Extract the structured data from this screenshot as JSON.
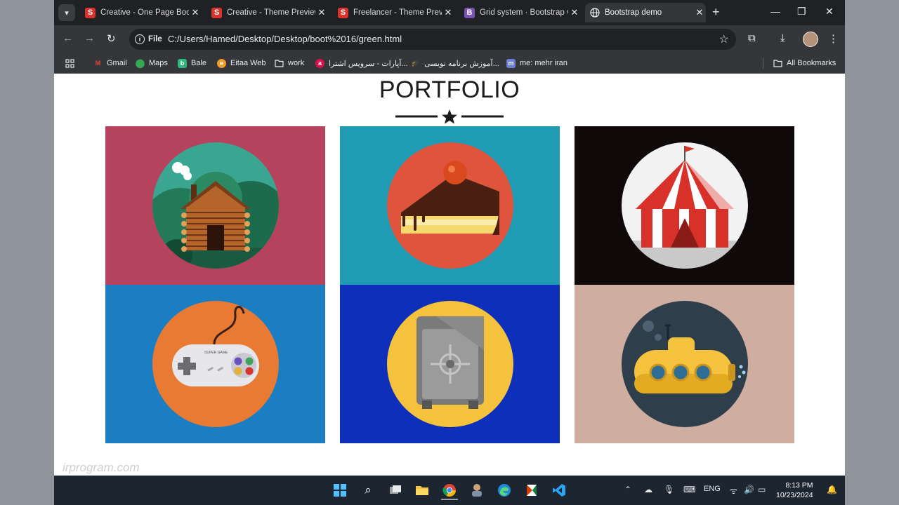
{
  "browser": {
    "tabs": [
      {
        "title": "Creative - One Page Boot",
        "favicon": "S",
        "favicon_color": "#d9342b",
        "active": false
      },
      {
        "title": "Creative - Theme Preview",
        "favicon": "S",
        "favicon_color": "#d9342b",
        "active": false
      },
      {
        "title": "Freelancer - Theme Previ",
        "favicon": "S",
        "favicon_color": "#d9342b",
        "active": false
      },
      {
        "title": "Grid system · Bootstrap v",
        "favicon": "B",
        "favicon_color": "#7952b3",
        "active": false
      },
      {
        "title": "Bootstrap demo",
        "favicon": "globe",
        "favicon_color": "#5f6368",
        "active": true
      }
    ],
    "address": {
      "scheme_label": "File",
      "url": "C:/Users/Hamed/Desktop/Desktop/boot%2016/green.html"
    },
    "bookmarks": [
      {
        "label": "Gmail",
        "icon": "gmail-icon",
        "color": "#ea4335"
      },
      {
        "label": "Maps",
        "icon": "maps-icon",
        "color": "#34a853"
      },
      {
        "label": "Bale",
        "icon": "bale-icon",
        "color": "#2eb67d"
      },
      {
        "label": "Eitaa Web",
        "icon": "eitaa-icon",
        "color": "#f29b2a"
      },
      {
        "label": "work",
        "icon": "folder-icon",
        "color": "#e8eaed"
      },
      {
        "label": "آپارات - سرویس اشترا...",
        "icon": "aparat-icon",
        "color": "#df0f50"
      },
      {
        "label": "آموزش برنامه نویسی...",
        "icon": "cap-icon",
        "color": "#e8eaed"
      },
      {
        "label": "me: mehr iran",
        "icon": "mehr-icon",
        "color": "#6b7fd7"
      }
    ],
    "all_bookmarks_label": "All Bookmarks"
  },
  "page": {
    "title": "PORTFOLIO",
    "tiles": [
      {
        "icon": "cabin-icon",
        "bg": "#b5435d",
        "circle": "#3aa591"
      },
      {
        "icon": "cake-icon",
        "bg": "#1f9cb3",
        "circle": "#e0533d"
      },
      {
        "icon": "circus-tent-icon",
        "bg": "#0f0a09",
        "circle": "#f2f2f2"
      },
      {
        "icon": "game-controller-icon",
        "bg": "#1b7ec2",
        "circle": "#e87a34"
      },
      {
        "icon": "safe-icon",
        "bg": "#0e2fba",
        "circle": "#f4c23d"
      },
      {
        "icon": "submarine-icon",
        "bg": "#cfada1",
        "circle": "#2e3e4b"
      }
    ],
    "watermark": "irprogram.com"
  },
  "taskbar": {
    "language": "ENG",
    "time": "8:13 PM",
    "date": "10/23/2024"
  }
}
